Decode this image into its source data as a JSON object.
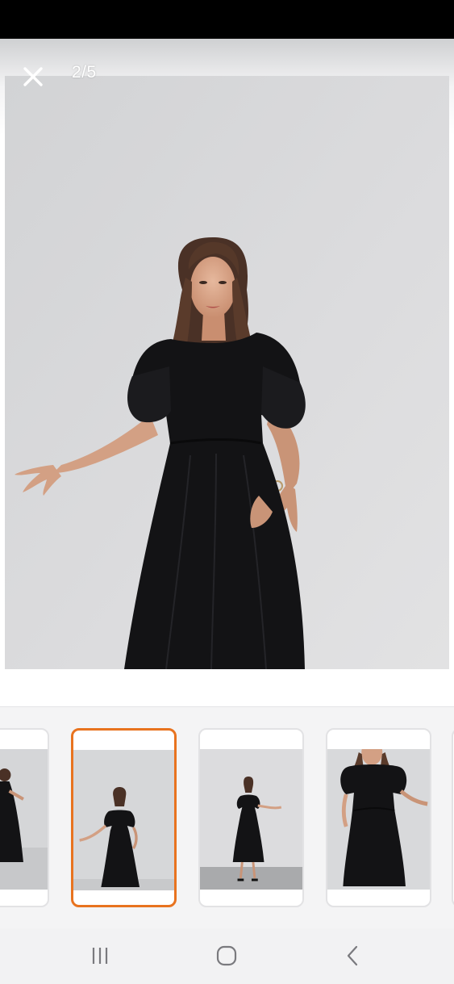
{
  "viewer": {
    "counter": "2/5",
    "current_index": 2,
    "total": 5
  },
  "icons": {
    "close": "close-icon",
    "recents": "recents-icon",
    "home": "home-icon",
    "back": "back-icon"
  },
  "thumbnails": [
    {
      "id": "thumb-1",
      "selected": false
    },
    {
      "id": "thumb-2",
      "selected": true
    },
    {
      "id": "thumb-3",
      "selected": false
    },
    {
      "id": "thumb-4",
      "selected": false
    }
  ],
  "colors": {
    "selected_border": "#e8731f",
    "dress": "#121214",
    "wall": "#d6d6d8"
  }
}
